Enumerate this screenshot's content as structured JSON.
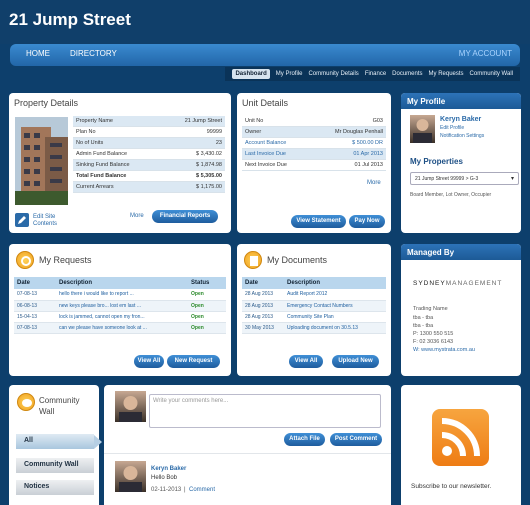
{
  "header": {
    "title": "21 Jump Street"
  },
  "nav": {
    "home": "HOME",
    "directory": "DIRECTORY",
    "account": "MY ACCOUNT"
  },
  "subnav": [
    "Dashboard",
    "My Profile",
    "Community Details",
    "Finance",
    "Documents",
    "My Requests",
    "Community Wall"
  ],
  "property": {
    "title": "Property Details",
    "rows": [
      {
        "label": "Property Name",
        "value": "21 Jump Street"
      },
      {
        "label": "Plan No",
        "value": "99999"
      },
      {
        "label": "No of Units",
        "value": "23"
      },
      {
        "label": "Admin Fund Balance",
        "value": "$ 3,430.02"
      },
      {
        "label": "Sinking Fund Balance",
        "value": "$ 1,874.98"
      },
      {
        "label": "Total Fund Balance",
        "value": "$ 5,305.00"
      },
      {
        "label": "Current Arrears",
        "value": "$ 1,175.00"
      }
    ],
    "edit_label": "Edit Site Contents",
    "more": "More",
    "reports_btn": "Financial Reports"
  },
  "unit": {
    "title": "Unit Details",
    "rows": [
      {
        "label": "Unit No",
        "value": "G03"
      },
      {
        "label": "Owner",
        "value": "Mr Douglas Penhall"
      },
      {
        "label": "Account Balance",
        "value": "$ 500.00 DR"
      },
      {
        "label": "Last Invoice Due",
        "value": "01 Apr 2013"
      },
      {
        "label": "Next Invoice Due",
        "value": "01 Jul 2013"
      }
    ],
    "more": "More",
    "statement_btn": "View Statement",
    "pay_btn": "Pay Now"
  },
  "profile": {
    "head": "My Profile",
    "name": "Keryn Baker",
    "edit": "Edit Profile",
    "notifications": "Notification Settings",
    "properties_title": "My Properties",
    "selected_property": "21 Jump Street 99999 > G-3",
    "roles": "Board Member, Lot Owner, Occupier"
  },
  "requests": {
    "title": "My Requests",
    "headers": [
      "Date",
      "Description",
      "Status"
    ],
    "rows": [
      {
        "date": "07-08-13",
        "desc": "hello there i would like to report ...",
        "status": "Open"
      },
      {
        "date": "06-08-13",
        "desc": "new keys please bro... lost em last ...",
        "status": "Open"
      },
      {
        "date": "15-04-13",
        "desc": "lock is jammed, cannot open my fron...",
        "status": "Open"
      },
      {
        "date": "07-08-13",
        "desc": "can we please have someone look at ...",
        "status": "Open"
      }
    ],
    "view_all": "View All",
    "new_btn": "New Request"
  },
  "documents": {
    "title": "My Documents",
    "headers": [
      "Date",
      "Description"
    ],
    "rows": [
      {
        "date": "28 Aug 2013",
        "desc": "Audit Report 2012"
      },
      {
        "date": "28 Aug 2013",
        "desc": "Emergency Contact Numbers"
      },
      {
        "date": "28 Aug 2013",
        "desc": "Community Site Plan"
      },
      {
        "date": "30 May 2013",
        "desc": "Uploading document on 30.5.13"
      }
    ],
    "view_all": "View All",
    "upload_btn": "Upload New"
  },
  "managed": {
    "head": "Managed By",
    "logo_left": "SYDNEY",
    "logo_right": "MANAGEMENT",
    "trading_label": "Trading Name",
    "trading_values": [
      "tba - tba",
      "tba - tba"
    ],
    "phone": "P:  1300 550 515",
    "fax": "F:  02 3036 6143",
    "web": "W:  www.mystrata.com.au"
  },
  "wall": {
    "title_line1": "Community",
    "title_line2": "Wall",
    "tabs": [
      "All",
      "Community Wall",
      "Notices"
    ],
    "comment_placeholder": "Write your comments here...",
    "attach_btn": "Attach File",
    "post_btn": "Post Comment",
    "post_author": "Keryn Baker",
    "post_text": "Hello Bob",
    "post_date": "02-11-2013",
    "post_sep": "|",
    "post_comment": "Comment"
  },
  "newsletter": {
    "text": "Subscribe to our newsletter."
  },
  "colors": {
    "accent": "#2266a8",
    "background": "#0d3f6c",
    "rss": "#f28a1e"
  }
}
